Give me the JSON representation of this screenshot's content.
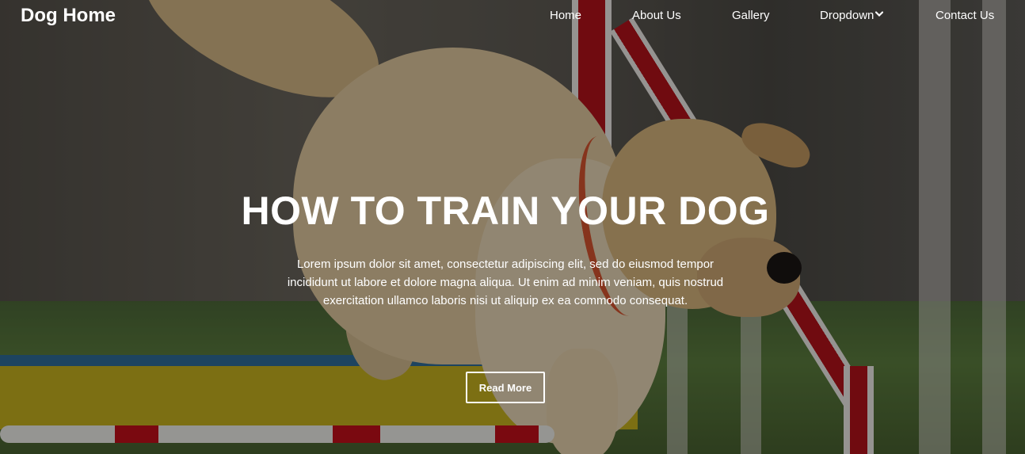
{
  "navbar": {
    "brand": "Dog Home",
    "items": [
      {
        "label": "Home"
      },
      {
        "label": "About Us"
      },
      {
        "label": "Gallery"
      },
      {
        "label": "Dropdown",
        "icon": "chevron-down-icon"
      },
      {
        "label": "Contact Us"
      }
    ]
  },
  "hero": {
    "title": "HOW TO TRAIN YOUR DOG",
    "text": "Lorem ipsum dolor sit amet, consectetur adipiscing elit, sed do eiusmod tempor incididunt ut labore et dolore magna aliqua. Ut enim ad minim veniam, quis nostrud exercitation ullamco laboris nisi ut aliquip ex ea commodo consequat.",
    "button_label": "Read More",
    "background_image": "dog-agility-jump-photo"
  },
  "colors": {
    "text": "#ffffff",
    "overlay": "rgba(0,0,0,0.38)"
  }
}
